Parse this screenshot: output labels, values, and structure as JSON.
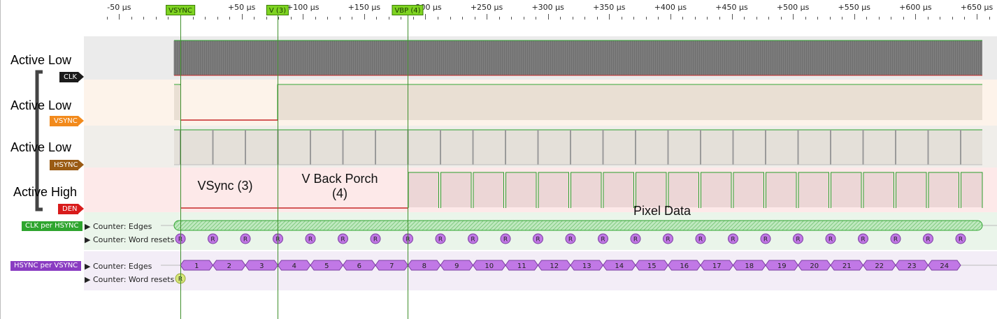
{
  "ruler": {
    "ticks": [
      "-50 µs",
      "0",
      "+50 µs",
      "+100 µs",
      "+150 µs",
      "+200 µs",
      "+250 µs",
      "+300 µs",
      "+350 µs",
      "+400 µs",
      "+450 µs",
      "+500 µs",
      "+550 µs",
      "+600 µs",
      "+650 µs"
    ]
  },
  "markers": [
    {
      "label": "VSYNC",
      "time_us": 0
    },
    {
      "label": "V (3)",
      "time_us": 78
    },
    {
      "label": "VBP (4)",
      "time_us": 182
    }
  ],
  "channels": [
    {
      "title": "Active Low",
      "tag": "CLK",
      "color": "#1b1b1b",
      "lane_color": "#ebebeb"
    },
    {
      "title": "Active Low",
      "tag": "VSYNC",
      "color": "#f28a1c",
      "lane_color": "#fdf3ea"
    },
    {
      "title": "Active Low",
      "tag": "HSYNC",
      "color": "#9a5b14",
      "lane_color": "#f0eeea"
    },
    {
      "title": "Active High",
      "tag": "DEN",
      "color": "#d81b1b",
      "lane_color": "#fde9e9"
    }
  ],
  "annotations": {
    "vsync": "VSync (3)",
    "vbp_line1": "V Back Porch",
    "vbp_line2": "(4)",
    "pixel": "Pixel Data"
  },
  "buses": [
    {
      "tag": "CLK per HSYNC",
      "color": "#2fa52f",
      "rows": [
        "Counter: Edges",
        "Counter: Word resets"
      ]
    },
    {
      "tag": "HSYNC per VSYNC",
      "color": "#8a3cc2",
      "rows": [
        "Counter: Edges",
        "Counter: Word resets"
      ]
    }
  ],
  "reset_symbol": "R",
  "hsync_counts": [
    "1",
    "2",
    "3",
    "4",
    "5",
    "6",
    "7",
    "8",
    "9",
    "10",
    "11",
    "12",
    "13",
    "14",
    "15",
    "16",
    "17",
    "18",
    "19",
    "20",
    "21",
    "22",
    "23",
    "24"
  ],
  "colors": {
    "wave_green": "#2a9d2a",
    "wave_red": "#c62828",
    "clk_fill": "#777777",
    "counter_purple": "#c178e6",
    "reset_green": "#d8e87a"
  }
}
